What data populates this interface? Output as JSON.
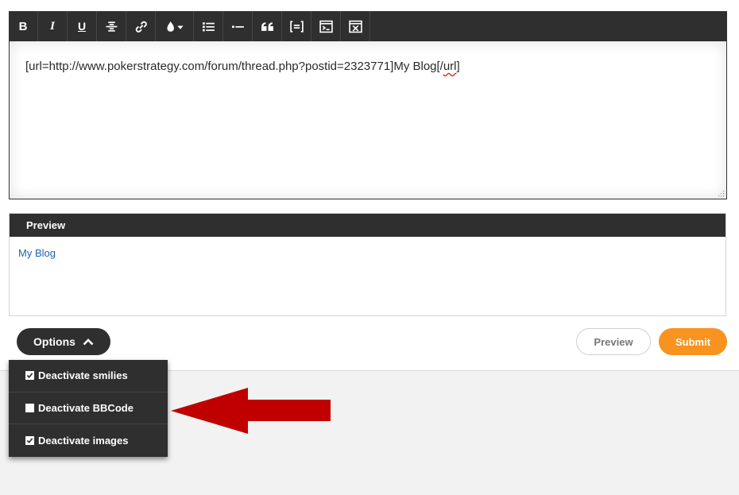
{
  "toolbar": {
    "buttons": [
      {
        "name": "bold-icon",
        "glyph": "B"
      },
      {
        "name": "italic-icon",
        "glyph": "I"
      },
      {
        "name": "underline-icon",
        "glyph": "U"
      },
      {
        "name": "strikethrough-icon",
        "glyph": ""
      },
      {
        "name": "link-icon",
        "glyph": ""
      },
      {
        "name": "color-drop-icon",
        "glyph": ""
      },
      {
        "name": "bulleted-list-icon",
        "glyph": ""
      },
      {
        "name": "list-item-icon",
        "glyph": ""
      },
      {
        "name": "quote-icon",
        "glyph": ""
      },
      {
        "name": "code-icon",
        "glyph": ""
      },
      {
        "name": "terminal-icon",
        "glyph": ""
      },
      {
        "name": "remove-format-icon",
        "glyph": ""
      }
    ]
  },
  "editor": {
    "text_before": "[url=http://www.pokerstrategy.com/forum/thread.php?postid=2323771]My Blog[/",
    "text_spell": "url",
    "text_after": "]"
  },
  "preview": {
    "header": "Preview",
    "link_text": "My Blog"
  },
  "actions": {
    "options_label": "Options",
    "preview_label": "Preview",
    "submit_label": "Submit"
  },
  "options_menu": {
    "items": [
      {
        "label": "Deactivate smilies",
        "checked": true
      },
      {
        "label": "Deactivate BBCode",
        "checked": false
      },
      {
        "label": "Deactivate images",
        "checked": true
      }
    ]
  },
  "colors": {
    "toolbar_bg": "#2f2f2f",
    "link": "#1a64b4",
    "submit": "#f7931e",
    "annotation_arrow": "#c00000"
  }
}
